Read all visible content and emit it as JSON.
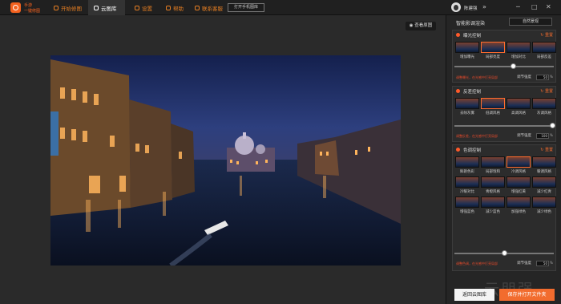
{
  "brand": {
    "line1": "手游",
    "line2": "一键修图"
  },
  "nav": [
    {
      "label": "开始修图",
      "icon": "start-edit-icon"
    },
    {
      "label": "云图库",
      "icon": "cloud-icon"
    },
    {
      "label": "设置",
      "icon": "gear-icon"
    },
    {
      "label": "帮助",
      "icon": "help-icon"
    },
    {
      "label": "联系客服",
      "icon": "support-icon"
    }
  ],
  "open_button": "打开手机图库",
  "user": {
    "name": "陈建强"
  },
  "viewer": {
    "view_original": "查看原图"
  },
  "panel": {
    "title": "智能影调渲染",
    "preset": "自然景观",
    "sections": [
      {
        "title": "曝光控制",
        "reset": "重置",
        "thumbs": [
          "增加曝光",
          "局部亮度",
          "增加对比",
          "局部反差"
        ],
        "selected": 1,
        "hint": "调整曝光，在光感中打亮局部",
        "intensity_label": "调节强度",
        "intensity_value": "50",
        "slider": 0.6
      },
      {
        "title": "反差控制",
        "reset": "重置",
        "thumbs": [
          "去除灰雾",
          "低调风格",
          "高调风格",
          "灰调风格"
        ],
        "selected": 1,
        "hint": "调整反差，在光感中打亮局部",
        "intensity_label": "调节强度",
        "intensity_value": "100",
        "slider": 1.0
      },
      {
        "title": "色调控制",
        "reset": "重置",
        "thumbs": [
          "鲜艳色彩",
          "局部饱和",
          "冷调风格",
          "暖调风格",
          "冷暖对比",
          "青橙风格",
          "增强红黄",
          "减少红青",
          "增强蓝色",
          "减少蓝色",
          "加强绿色",
          "减少绿色"
        ],
        "selected": 2,
        "hint": "调整色调，在光感中打亮局部",
        "intensity_label": "调节强度",
        "intensity_value": "50",
        "slider": 0.5
      }
    ]
  },
  "buttons": {
    "back": "返回云图库",
    "save": "保存并打开文件夹"
  },
  "percent_sign": "%",
  "watermark": "云朋强"
}
